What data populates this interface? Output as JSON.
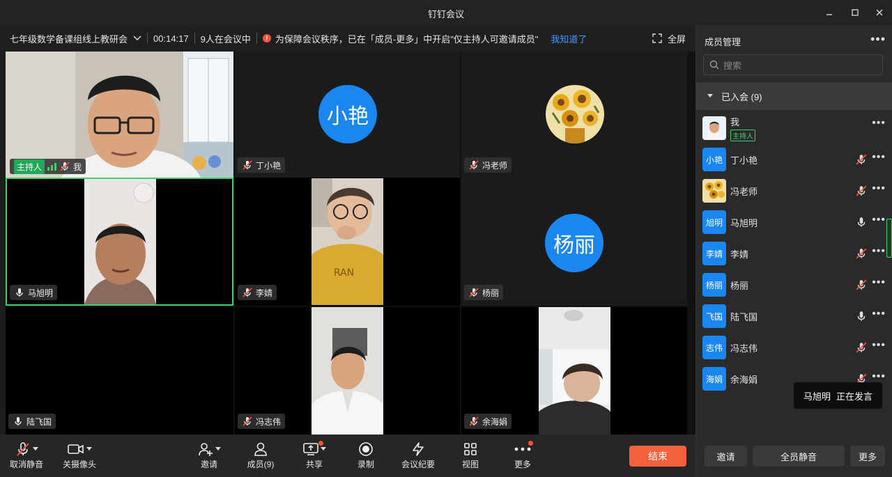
{
  "window": {
    "title": "钉钉会议"
  },
  "infobar": {
    "meeting_name": "七年级数学备课组线上教研会",
    "duration": "00:14:17",
    "attendance": "9人在会议中",
    "notice": "为保障会议秩序，已在「成员-更多」中开启\"仅主持人可邀请成员\"",
    "ack_link": "我知道了",
    "fullscreen": "全屏"
  },
  "tiles": [
    {
      "name": "我",
      "host_badge": "主持人",
      "type": "video",
      "mic": "muted"
    },
    {
      "name": "丁小艳",
      "avatar_text": "小艳",
      "type": "avatar",
      "mic": "muted"
    },
    {
      "name": "冯老师",
      "type": "image-avatar",
      "mic": "muted"
    },
    {
      "name": "马旭明",
      "type": "video",
      "mic": "on",
      "active_speaker": true
    },
    {
      "name": "李婧",
      "type": "video",
      "mic": "muted"
    },
    {
      "name": "杨丽",
      "avatar_text": "杨丽",
      "type": "avatar",
      "mic": "muted"
    },
    {
      "name": "陆飞国",
      "type": "none",
      "mic": "on"
    },
    {
      "name": "冯志伟",
      "type": "video",
      "mic": "muted"
    },
    {
      "name": "余海娟",
      "type": "video",
      "mic": "muted"
    }
  ],
  "toolbar": {
    "unmute": "取消静音",
    "camera_off": "关摄像头",
    "invite": "邀请",
    "members": "成员(9)",
    "share": "共享",
    "record": "录制",
    "minutes": "会议纪要",
    "view": "视图",
    "more": "更多",
    "end": "结束"
  },
  "panel": {
    "title": "成员管理",
    "search_placeholder": "搜索",
    "group_label": "已入会 (9)",
    "members": [
      {
        "name": "我",
        "role": "主持人",
        "avatar": "photo",
        "mic": "none"
      },
      {
        "name": "丁小艳",
        "avatar_text": "小艳",
        "mic": "muted"
      },
      {
        "name": "冯老师",
        "avatar": "sunflower",
        "mic": "muted"
      },
      {
        "name": "马旭明",
        "avatar_text": "旭明",
        "mic": "on"
      },
      {
        "name": "李婧",
        "avatar_text": "李婧",
        "mic": "muted"
      },
      {
        "name": "杨丽",
        "avatar_text": "杨丽",
        "mic": "muted"
      },
      {
        "name": "陆飞国",
        "avatar_text": "飞国",
        "mic": "on"
      },
      {
        "name": "冯志伟",
        "avatar_text": "志伟",
        "mic": "muted"
      },
      {
        "name": "余海娟",
        "avatar_text": "海娟",
        "mic": "muted"
      }
    ],
    "tooltip_name": "马旭明",
    "tooltip_status": "正在发言",
    "invite_btn": "邀请",
    "mute_all_btn": "全员静音",
    "more_btn": "更多"
  },
  "colors": {
    "accent": "#1a86f0",
    "host_green": "#23a85b",
    "end_orange": "#f2613c",
    "active_border": "#3fcf6c"
  }
}
